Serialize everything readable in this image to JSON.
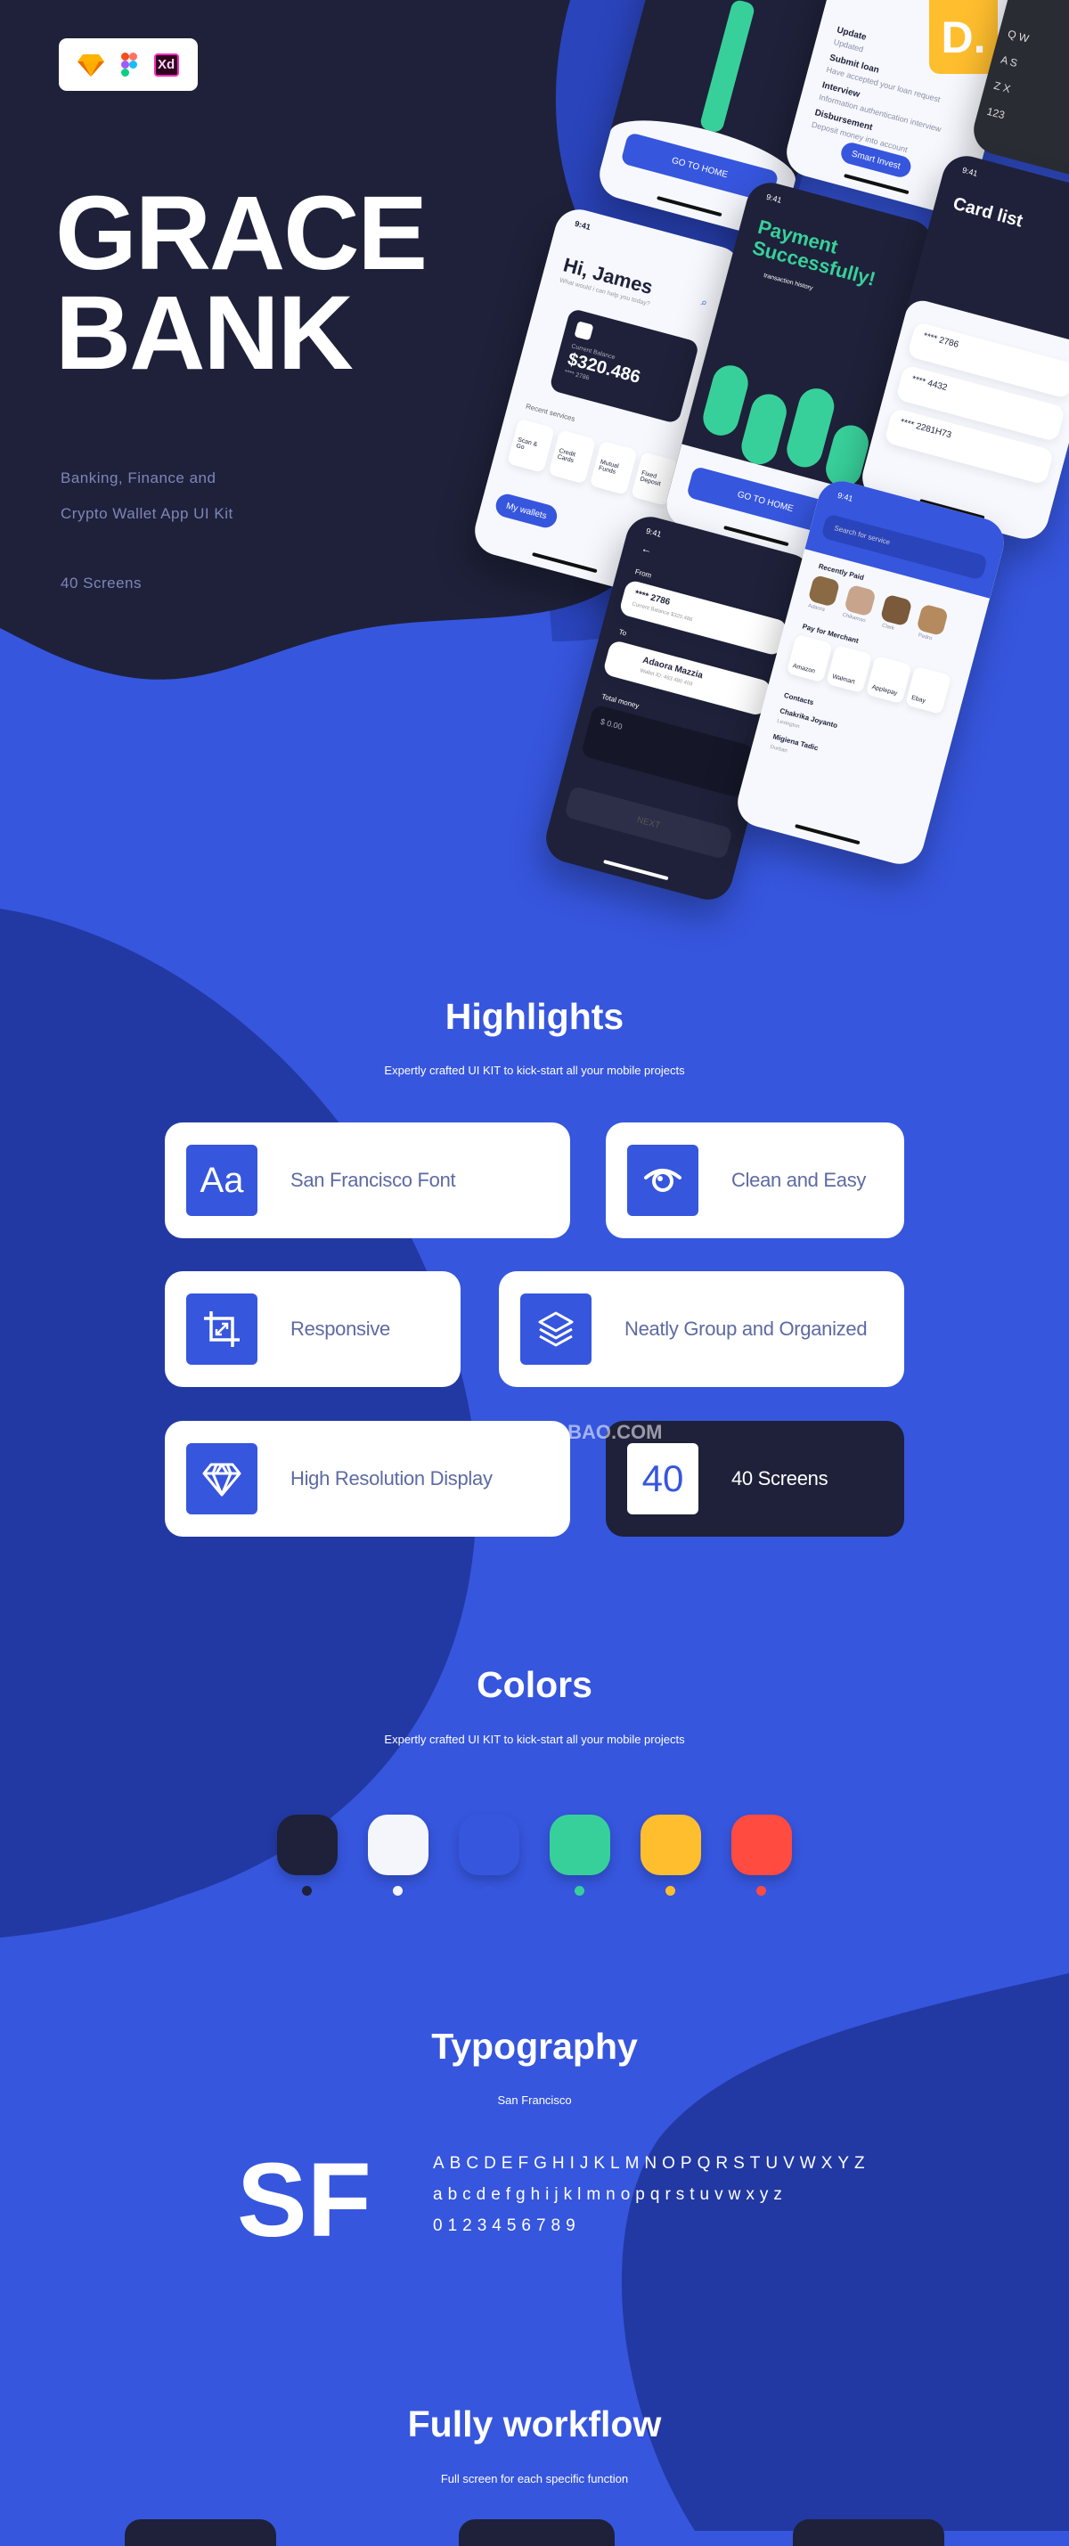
{
  "hero": {
    "title_line1": "GRACE",
    "title_line2": "BANK",
    "subtitle_line1": "Banking, Finance and",
    "subtitle_line2": "Crypto Wallet App UI Kit",
    "screens": "40 Screens",
    "tools": [
      "sketch-icon",
      "figma-icon",
      "xd-icon"
    ],
    "xd_label": "Xd",
    "brand_badge": "D."
  },
  "phones": {
    "success": {
      "button": "GO TO HOME"
    },
    "home": {
      "time": "9:41",
      "greeting": "Hi, James",
      "question": "What would i can help you today?",
      "balance_label": "Current Balance",
      "balance": "$320.486",
      "card_no": "**** 2786",
      "recent": "Recent services",
      "services": [
        "Scan & Go",
        "Credit Cards",
        "Mutual Funds",
        "Fixed Deposit"
      ],
      "wallet_btn": "My wallets"
    },
    "loan": {
      "steps": [
        {
          "title": "Update",
          "desc": "Updated"
        },
        {
          "title": "Submit loan",
          "desc": "Have accepted your loan request"
        },
        {
          "title": "Interview",
          "desc": "Information authentication interview"
        },
        {
          "title": "Disbursement",
          "desc": "Deposit money into account"
        }
      ],
      "button": "Smart Invest"
    },
    "payment": {
      "time": "9:41",
      "title": "Payment Successfully!",
      "link": "transaction history",
      "button": "GO TO HOME"
    },
    "cards": {
      "time": "9:41",
      "title": "Card list",
      "items": [
        "**** 2786",
        "**** 4432",
        "**** 2281H73"
      ]
    },
    "transfer": {
      "time": "9:41",
      "from": "From",
      "from_card": "**** 2786",
      "from_sub": "Current Balance $320.486",
      "to": "To",
      "to_name": "Adaora Mazzia",
      "to_sub": "Wallet ID: 493 480 409",
      "total": "Total money",
      "amount": "$ 0.00",
      "next": "NEXT"
    },
    "search": {
      "time": "9:41",
      "placeholder": "Search for service",
      "recent": "Recently Paid",
      "people": [
        "Adaora",
        "Chikamso",
        "Clark",
        "Pedro"
      ],
      "merchant_title": "Pay for Merchant",
      "merchants": [
        "Amazon",
        "Walmart",
        "Applepay",
        "Ebay"
      ],
      "contacts_title": "Contacts",
      "contacts": [
        {
          "name": "Chakrika Joyanto",
          "city": "Lexington"
        },
        {
          "name": "Migiena Tadic",
          "city": "Durban"
        }
      ]
    },
    "keyboard": {
      "keys": [
        "Q",
        "W",
        "A",
        "S",
        "Z",
        "X",
        "123"
      ]
    }
  },
  "highlights": {
    "title": "Highlights",
    "subtitle": "Expertly crafted UI KIT to kick-start all your mobile projects",
    "items": [
      {
        "label": "San Francisco Font",
        "icon": "Aa"
      },
      {
        "label": "Clean and Easy",
        "icon": "eye-icon"
      },
      {
        "label": "Responsive",
        "icon": "crop-icon"
      },
      {
        "label": "Neatly Group and  Organized",
        "icon": "layers-icon"
      },
      {
        "label": "High Resolution Display",
        "icon": "diamond-icon"
      },
      {
        "label": "40 Screens",
        "icon": "40"
      }
    ],
    "watermark": "早道大咖  IAMDK.TAOBAO.COM"
  },
  "colors": {
    "title": "Colors",
    "subtitle": "Expertly crafted UI KIT to kick-start all your mobile projects",
    "swatches": [
      "#1E2139",
      "#F4F6FB",
      "#3656DE",
      "#38D09A",
      "#FFBE2E",
      "#FF4B40"
    ]
  },
  "typography": {
    "title": "Typography",
    "font_name": "San Francisco",
    "sample": "SF",
    "uppercase": "ABCDEFGHIJKLMNOPQRSTUVWXYZ",
    "lowercase": "abcdefghijklmnopqrstuvwxyz",
    "digits": "0123456789"
  },
  "workflow": {
    "title": "Fully workflow",
    "subtitle": "Full screen for each specific function"
  },
  "theme": {
    "accent": "#3656DE",
    "dark": "#1E2139",
    "deep_blue": "#2239A3"
  }
}
